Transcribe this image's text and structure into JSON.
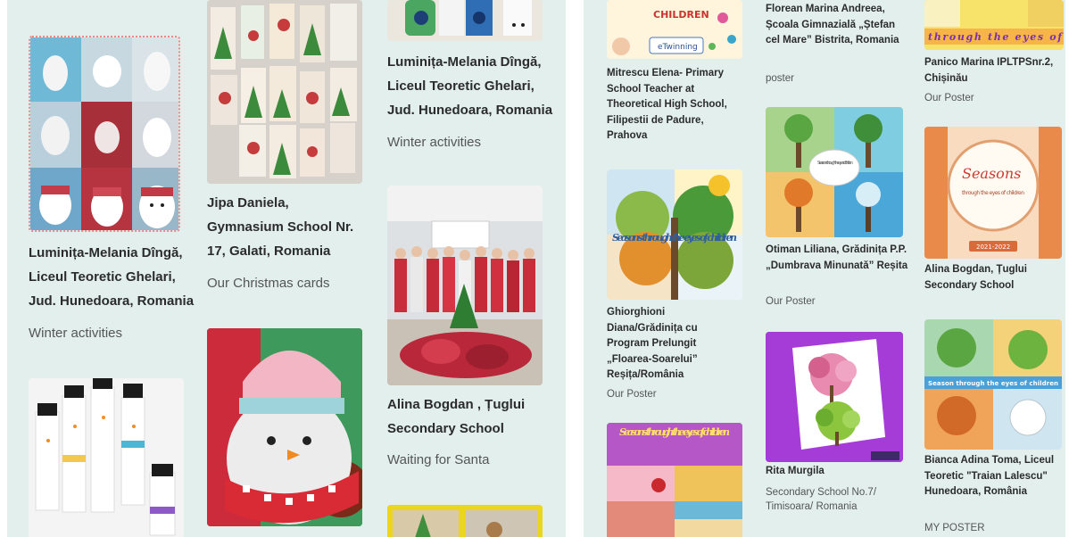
{
  "left_feed": {
    "posts": [
      {
        "title": "Luminița-Melania Dîngă, Liceul Teoretic Ghelari, Jud. Hunedoara, Romania",
        "subtitle": "Winter activities",
        "image": "snowman-craft-steps-collage"
      },
      {
        "title": "",
        "subtitle": "",
        "image": "paper-snowmen-puppets"
      },
      {
        "title": "Jipa Daniela, Gymnasium School Nr. 17, Galati, Romania",
        "subtitle": "Our Christmas cards",
        "image": "christmas-cards-wall"
      },
      {
        "title": "",
        "subtitle": "",
        "image": "plush-snowman-closeup"
      },
      {
        "title": "Luminița-Melania Dîngă, Liceul Teoretic Ghelari, Jud. Hunedoara, Romania",
        "subtitle": "Winter activities",
        "image": "snowman-craft-sticks"
      },
      {
        "title": "Alina Bogdan , Țuglui Secondary School",
        "subtitle": "Waiting for Santa",
        "image": "class-photo-santa-hats"
      },
      {
        "title": "",
        "subtitle": "",
        "image": "christmas-craft-photo"
      }
    ]
  },
  "right_feed": {
    "posts": [
      {
        "title": "Mitrescu Elena- Primary School Teacher at Theoretical High School, Filipestii de Padure, Prahova",
        "subtitle": "",
        "image": "children-etwinning-poster",
        "image_text": [
          "CHILDREN",
          "eTwinning"
        ]
      },
      {
        "title": "Ghiorghioni Diana/Grădinița cu Program Prelungit „Floarea-Soarelui” Reșița/România",
        "subtitle": "Our Poster",
        "image": "seasons-tree-poster",
        "image_text": [
          "Seasons through the eyes of children"
        ]
      },
      {
        "title": "",
        "subtitle": "",
        "image": "seasons-collage-poster",
        "image_text": [
          "Seasons through the eyes of children"
        ]
      },
      {
        "title": "Florean Marina Andreea, Școala Gimnazială „Ștefan cel Mare” Bistrita, Romania",
        "subtitle": "poster",
        "image": ""
      },
      {
        "title": "Otiman Liliana, Grădinița P.P. „Dumbrava Minunată” Reșita",
        "subtitle": "Our Poster",
        "image": "four-seasons-trees-grid",
        "image_text": [
          "Seasons through the eyes of children"
        ]
      },
      {
        "title": "Rita Murgila",
        "subtitle": "Secondary School No.7/ Timisoara/ Romania",
        "image": "seasons-cube-trees"
      },
      {
        "title": "Panico Marina IPLTPSnr.2, Chișinău",
        "subtitle": "Our Poster",
        "image": "seasons-banner-poster",
        "image_text": [
          "through the eyes of"
        ]
      },
      {
        "title": "Alina Bogdan, Țuglui Secondary School",
        "subtitle": "",
        "image": "seasons-book-cover",
        "image_text": [
          "Seasons",
          "through the eyes of children",
          "2021-2022"
        ]
      },
      {
        "title": "Bianca Adina Toma, Liceul Teoretic \"Traian Lalescu\" Hunedoara, România",
        "subtitle": "MY POSTER",
        "image": "seasons-trees-poster-2",
        "image_text": [
          "Season through the eyes of children"
        ]
      }
    ]
  },
  "colors": {
    "panel_bg": "#e2efed",
    "text": "#2b2b2b",
    "muted": "#555555"
  }
}
